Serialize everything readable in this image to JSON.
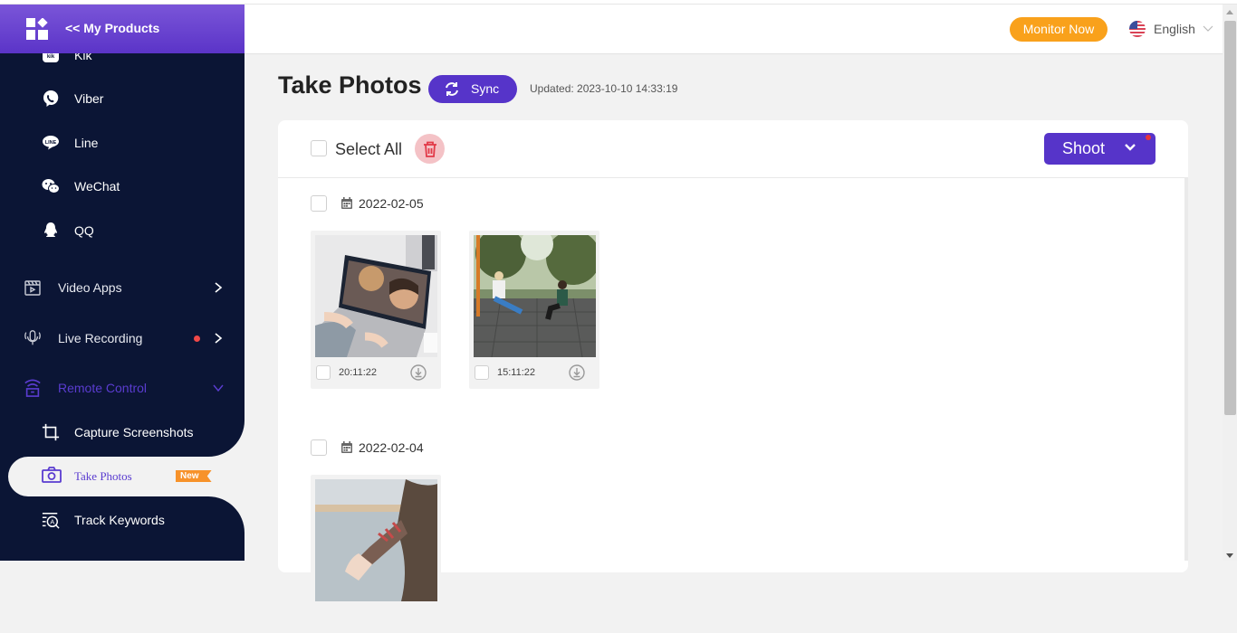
{
  "sidebar": {
    "header_title": "<< My Products",
    "apps": [
      {
        "label": "Kik",
        "icon": "kik-icon"
      },
      {
        "label": "Viber",
        "icon": "viber-icon"
      },
      {
        "label": "Line",
        "icon": "line-icon"
      },
      {
        "label": "WeChat",
        "icon": "wechat-icon"
      },
      {
        "label": "QQ",
        "icon": "qq-icon"
      }
    ],
    "sections": [
      {
        "label": "Video Apps",
        "icon": "video-icon",
        "state": "collapsed"
      },
      {
        "label": "Live Recording",
        "icon": "microphone-icon",
        "state": "collapsed",
        "has_dot": true
      },
      {
        "label": "Remote Control",
        "icon": "remote-icon",
        "state": "expanded"
      }
    ],
    "sub_items": [
      {
        "label": "Capture Screenshots",
        "icon": "crop-icon"
      },
      {
        "label": "Take Photos",
        "icon": "camera-icon",
        "active": true,
        "badge": "New"
      },
      {
        "label": "Track Keywords",
        "icon": "keyword-search-icon"
      }
    ]
  },
  "topbar": {
    "monitor_now": "Monitor Now",
    "language": "English"
  },
  "page": {
    "title": "Take Photos",
    "sync_label": "Sync",
    "updated": "Updated: 2023-10-10 14:33:19",
    "select_all": "Select All",
    "shoot_label": "Shoot"
  },
  "groups": [
    {
      "date": "2022-02-05",
      "photos": [
        {
          "time": "20:11:22",
          "subject": "laptop video call"
        },
        {
          "time": "15:11:22",
          "subject": "two women on swings"
        }
      ]
    },
    {
      "date": "2022-02-04",
      "photos": [
        {
          "time": "",
          "subject": "holding hands by the sea"
        }
      ]
    }
  ],
  "colors": {
    "brand_purple": "#5634c9",
    "sidebar_bg": "#0b1535",
    "monitor_orange": "#f9a11b",
    "badge_orange": "#f7922a",
    "alert_red": "#f04848"
  }
}
